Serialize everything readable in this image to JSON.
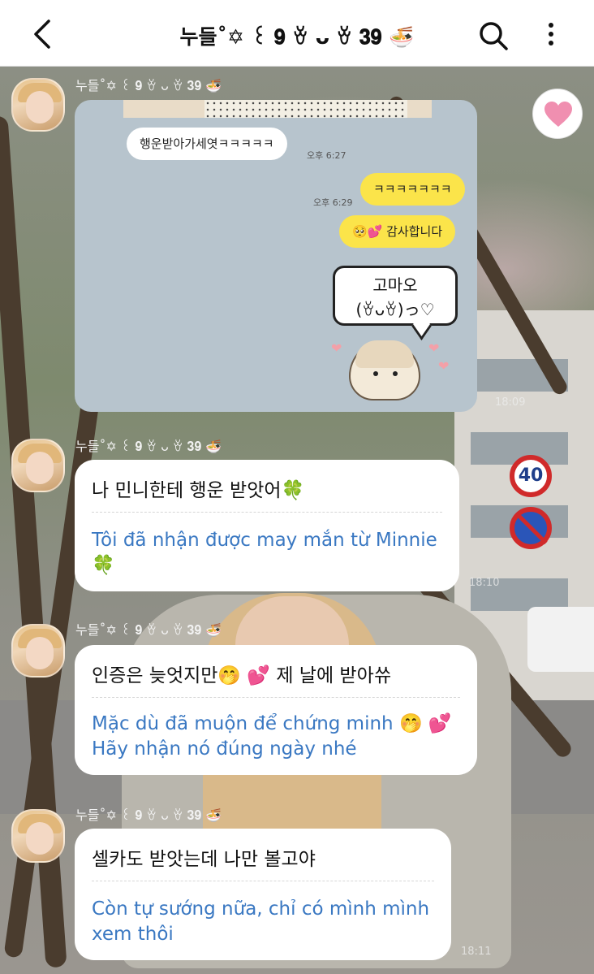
{
  "header": {
    "title": "누들˚✡︎ ꒰ 𝟗 ꈊ ᴗ ꈊ 𝟑𝟗 🍜"
  },
  "sender_name": "누들˚✡︎ ꒰ 𝟗 ꈊ ᴗ ꈊ 𝟑𝟗 🍜",
  "image_message": {
    "bubble1": "행운받아가세엿ㅋㅋㅋㅋㅋ",
    "time1": "오후 6:27",
    "time2": "오후 6:29",
    "bubble2": "ㅋㅋㅋㅋㅋㅋㅋ",
    "bubble3": "🥺💕 감사합니다",
    "sticker_text": "고마오\n(ꈊᴗꈊ)っ♡"
  },
  "messages": [
    {
      "original": "나 민니한테 행운 받앗어🍀",
      "translation": "Tôi đã nhận được may mắn từ Minnie 🍀"
    },
    {
      "original": "인증은 늦엇지만🤭 💕 제 날에 받아쓔",
      "translation": "Mặc dù đã muộn để chứng minh 🤭 💕 Hãy nhận nó đúng ngày nhé"
    },
    {
      "original": "셀카도 받앗는데 나만 볼고야",
      "translation": "Còn tự sướng nữa, chỉ có mình mình xem thôi"
    }
  ],
  "background_times": [
    "18:09",
    "18:10",
    "18:11"
  ],
  "sign_speed": "40",
  "colors": {
    "header_bg": "#ffffff",
    "bubble_yellow": "#fbe44a",
    "translation_blue": "#3a78c2",
    "reaction_heart": "#f08fb0"
  }
}
